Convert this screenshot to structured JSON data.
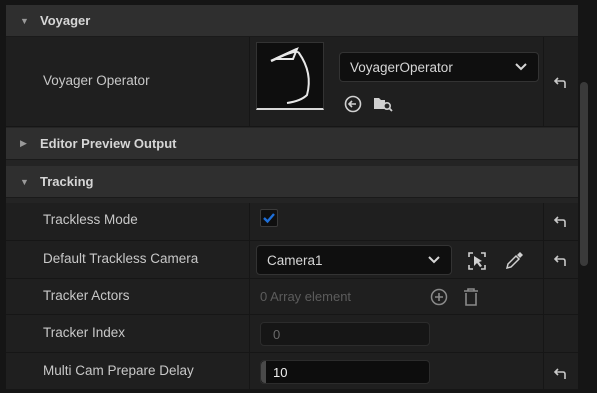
{
  "sections": {
    "voyager": {
      "title": "Voyager"
    },
    "editor_preview": {
      "title": "Editor Preview Output"
    },
    "tracking": {
      "title": "Tracking"
    }
  },
  "voyager_operator": {
    "label": "Voyager Operator",
    "selected": "VoyagerOperator"
  },
  "trackless_mode": {
    "label": "Trackless Mode",
    "checked": true
  },
  "default_trackless_camera": {
    "label": "Default Trackless Camera",
    "selected": "Camera1"
  },
  "tracker_actors": {
    "label": "Tracker Actors",
    "value": "0 Array element"
  },
  "tracker_index": {
    "label": "Tracker Index",
    "value": "0"
  },
  "multi_cam_delay": {
    "label": "Multi Cam Prepare Delay",
    "value": "10"
  },
  "icons": [
    "expanded-arrow-icon",
    "collapsed-arrow-icon",
    "reset-to-default-icon",
    "chevron-down-icon",
    "use-selected-icon",
    "browse-icon",
    "select-actor-icon",
    "eyedropper-icon",
    "add-element-icon",
    "empty-array-icon"
  ],
  "colors": {
    "accent": "#1e6fd9",
    "background": "#242424",
    "section_header": "#2f2f2f",
    "row": "#1f1f1f"
  }
}
